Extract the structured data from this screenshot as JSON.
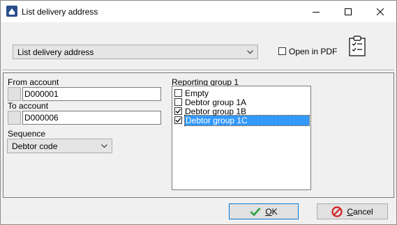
{
  "window": {
    "title": "List delivery address"
  },
  "toolbar": {
    "report_select_value": "List delivery address",
    "open_in_pdf_label": "Open in PDF",
    "open_in_pdf_checked": false
  },
  "form": {
    "from_account_label": "From account",
    "from_account_value": "D000001",
    "to_account_label": "To account",
    "to_account_value": "D000006",
    "sequence_label": "Sequence",
    "sequence_value": "Debtor code",
    "reporting_group_label": "Reporting group 1",
    "reporting_groups": [
      {
        "label": "Empty",
        "checked": false,
        "selected": false
      },
      {
        "label": "Debtor group 1A",
        "checked": false,
        "selected": false
      },
      {
        "label": "Debtor group 1B",
        "checked": true,
        "selected": false
      },
      {
        "label": "Debtor group 1C",
        "checked": true,
        "selected": true
      }
    ]
  },
  "buttons": {
    "ok_hotkey": "O",
    "ok_rest": "K",
    "cancel_hotkey": "C",
    "cancel_rest": "ancel"
  },
  "colors": {
    "selection": "#3399ff",
    "ok_check": "#2ea043",
    "cancel_icon": "#d21f1f"
  }
}
